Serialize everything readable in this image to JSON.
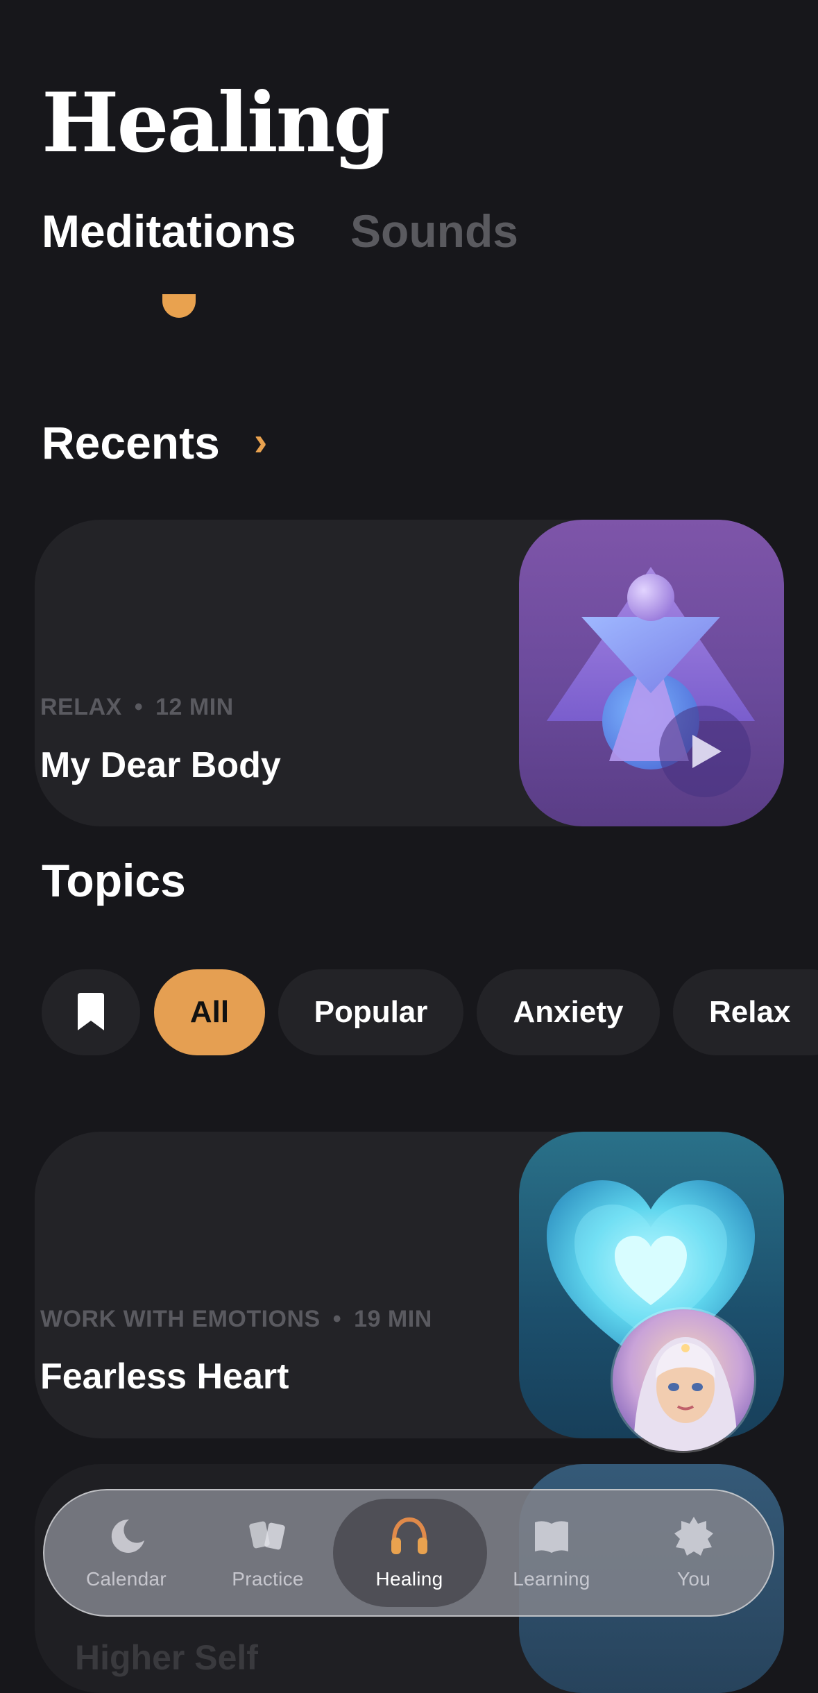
{
  "header": {
    "title": "Healing",
    "tabs": [
      {
        "label": "Meditations",
        "active": true
      },
      {
        "label": "Sounds",
        "active": false
      }
    ]
  },
  "recents": {
    "title": "Recents",
    "chevron": "›",
    "card": {
      "category": "RELAX",
      "separator": "•",
      "duration": "12 MIN",
      "title": "My Dear Body"
    }
  },
  "topics": {
    "title": "Topics",
    "chips": [
      {
        "icon": "bookmark-icon"
      },
      {
        "label": "All",
        "selected": true
      },
      {
        "label": "Popular",
        "selected": false
      },
      {
        "label": "Anxiety",
        "selected": false
      },
      {
        "label": "Relax",
        "selected": false
      }
    ]
  },
  "meditations": [
    {
      "category": "WORK WITH EMOTIONS",
      "separator": "•",
      "duration": "19 MIN",
      "title": "Fearless Heart"
    },
    {
      "title": "Higher Self"
    }
  ],
  "tabbar": {
    "items": [
      {
        "label": "Calendar",
        "icon": "moon-icon",
        "active": false
      },
      {
        "label": "Practice",
        "icon": "cards-icon",
        "active": false
      },
      {
        "label": "Healing",
        "icon": "headphones-icon",
        "active": true
      },
      {
        "label": "Learning",
        "icon": "book-icon",
        "active": false
      },
      {
        "label": "You",
        "icon": "gear-icon",
        "active": false
      }
    ]
  },
  "colors": {
    "background": "#17171b",
    "accent": "#e59f52",
    "card": "#232327",
    "muted_text": "#5a5a60"
  }
}
